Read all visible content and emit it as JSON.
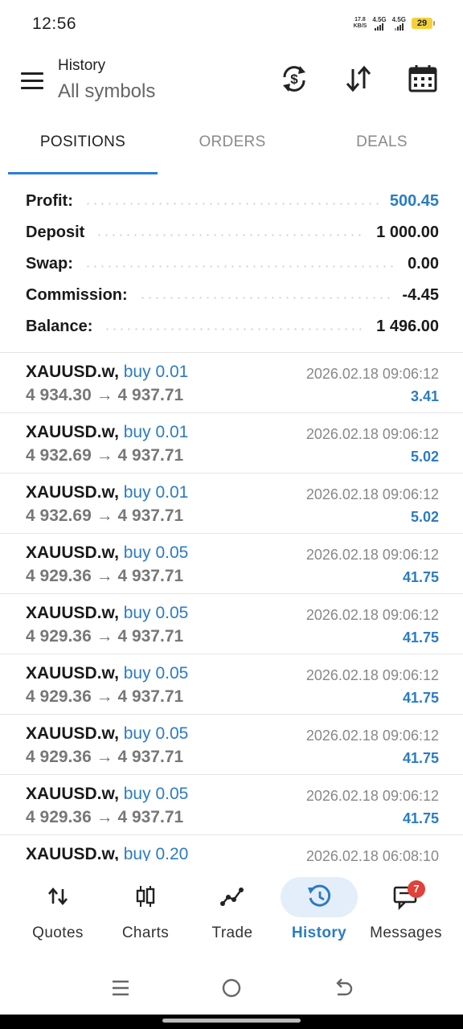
{
  "status_bar": {
    "time": "12:56",
    "net_speed_value": "17.8",
    "net_speed_unit": "KB/S",
    "signal1_label": "4.5G",
    "signal2_label": "4.5G",
    "battery": "29"
  },
  "header": {
    "title": "History",
    "subtitle": "All symbols"
  },
  "tabs": [
    {
      "label": "POSITIONS",
      "active": true
    },
    {
      "label": "ORDERS",
      "active": false
    },
    {
      "label": "DEALS",
      "active": false
    }
  ],
  "summary": [
    {
      "label": "Profit:",
      "value": "500.45",
      "accent": "#2b7cc3"
    },
    {
      "label": "Deposit",
      "value": "1 000.00"
    },
    {
      "label": "Swap:",
      "value": "0.00"
    },
    {
      "label": "Commission:",
      "value": "-4.45"
    },
    {
      "label": "Balance:",
      "value": "1 496.00"
    }
  ],
  "deals": [
    {
      "symbol": "XAUUSD.w,",
      "side": "buy 0.01",
      "date": "2026.02.18 09:06:12",
      "open": "4 934.30",
      "close": "4 937.71",
      "profit": "3.41"
    },
    {
      "symbol": "XAUUSD.w,",
      "side": "buy 0.01",
      "date": "2026.02.18 09:06:12",
      "open": "4 932.69",
      "close": "4 937.71",
      "profit": "5.02"
    },
    {
      "symbol": "XAUUSD.w,",
      "side": "buy 0.01",
      "date": "2026.02.18 09:06:12",
      "open": "4 932.69",
      "close": "4 937.71",
      "profit": "5.02"
    },
    {
      "symbol": "XAUUSD.w,",
      "side": "buy 0.05",
      "date": "2026.02.18 09:06:12",
      "open": "4 929.36",
      "close": "4 937.71",
      "profit": "41.75"
    },
    {
      "symbol": "XAUUSD.w,",
      "side": "buy 0.05",
      "date": "2026.02.18 09:06:12",
      "open": "4 929.36",
      "close": "4 937.71",
      "profit": "41.75"
    },
    {
      "symbol": "XAUUSD.w,",
      "side": "buy 0.05",
      "date": "2026.02.18 09:06:12",
      "open": "4 929.36",
      "close": "4 937.71",
      "profit": "41.75"
    },
    {
      "symbol": "XAUUSD.w,",
      "side": "buy 0.05",
      "date": "2026.02.18 09:06:12",
      "open": "4 929.36",
      "close": "4 937.71",
      "profit": "41.75"
    },
    {
      "symbol": "XAUUSD.w,",
      "side": "buy 0.05",
      "date": "2026.02.18 09:06:12",
      "open": "4 929.36",
      "close": "4 937.71",
      "profit": "41.75"
    },
    {
      "symbol": "XAUUSD.w,",
      "side": "buy 0.20",
      "date": "2026.02.18 06:08:10",
      "open": "",
      "close": "",
      "profit": ""
    }
  ],
  "arrow": "→",
  "bottom_nav": [
    {
      "label": "Quotes",
      "icon": "quotes-icon"
    },
    {
      "label": "Charts",
      "icon": "charts-icon"
    },
    {
      "label": "Trade",
      "icon": "trade-icon"
    },
    {
      "label": "History",
      "icon": "history-icon",
      "active": true
    },
    {
      "label": "Messages",
      "icon": "messages-icon",
      "badge": "7"
    }
  ],
  "colors": {
    "accent": "#2b7cc3",
    "badge": "#e0423a",
    "active_pill": "#e4eefa"
  }
}
